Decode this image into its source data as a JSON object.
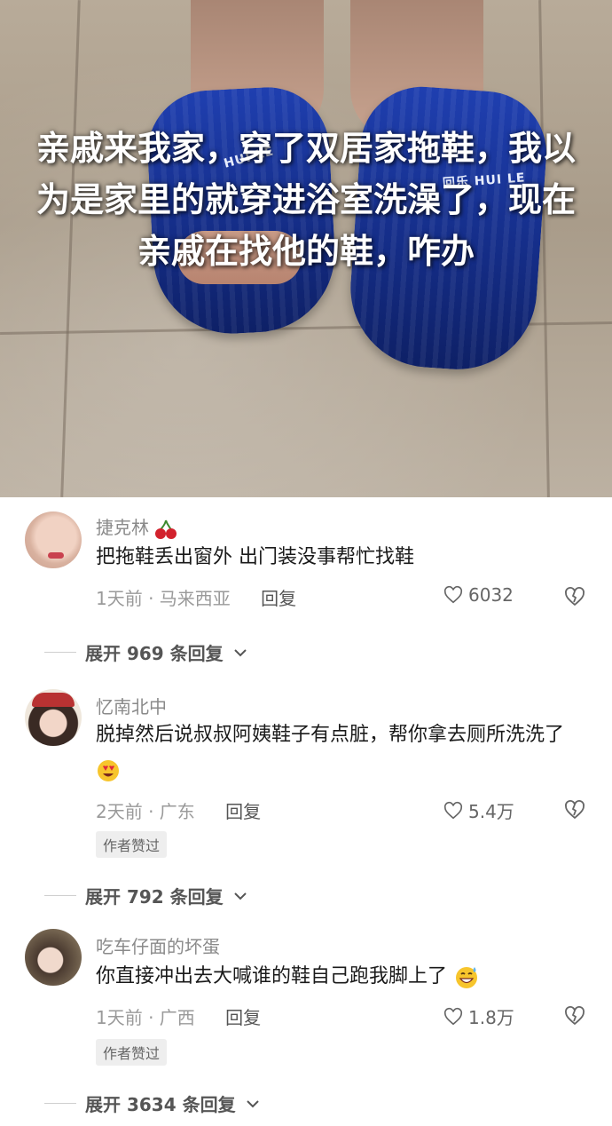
{
  "post": {
    "caption": "亲戚来我家，穿了双居家拖鞋，我以为是家里的就穿进浴室洗澡了，现在亲戚在找他的鞋，咋办",
    "slipper_left_logo": "HUI LE",
    "slipper_right_logo": "回乐 HUI LE"
  },
  "comments": [
    {
      "username": "捷克林",
      "username_emoji": "cherry-emoji",
      "text": "把拖鞋丢出窗外 出门装没事帮忙找鞋",
      "time_location": "1天前 · 马来西亚",
      "reply_label": "回复",
      "likes": "6032",
      "author_liked": false,
      "expand_label": "展开 969 条回复"
    },
    {
      "username": "忆南北中",
      "text": "脱掉然后说叔叔阿姨鞋子有点脏，帮你拿去厕所洗洗了",
      "trailing_emoji": "heart-eyes-emoji",
      "time_location": "2天前 · 广东",
      "reply_label": "回复",
      "likes": "5.4万",
      "author_liked": true,
      "badge": "作者赞过",
      "expand_label": "展开 792 条回复"
    },
    {
      "username": "吃车仔面的坏蛋",
      "text": "你直接冲出去大喊谁的鞋自己跑我脚上了",
      "trailing_emoji": "sweat-smile-emoji",
      "time_location": "1天前 · 广西",
      "reply_label": "回复",
      "likes": "1.8万",
      "author_liked": true,
      "badge": "作者赞过",
      "expand_label": "展开 3634 条回复"
    }
  ],
  "icons": {
    "like": "heart-outline-icon",
    "dislike": "broken-heart-outline-icon",
    "expand": "chevron-down-icon"
  },
  "colors": {
    "username": "#8a8a8a",
    "meta": "#9a9a9a",
    "badge_bg": "#eeeeee"
  }
}
